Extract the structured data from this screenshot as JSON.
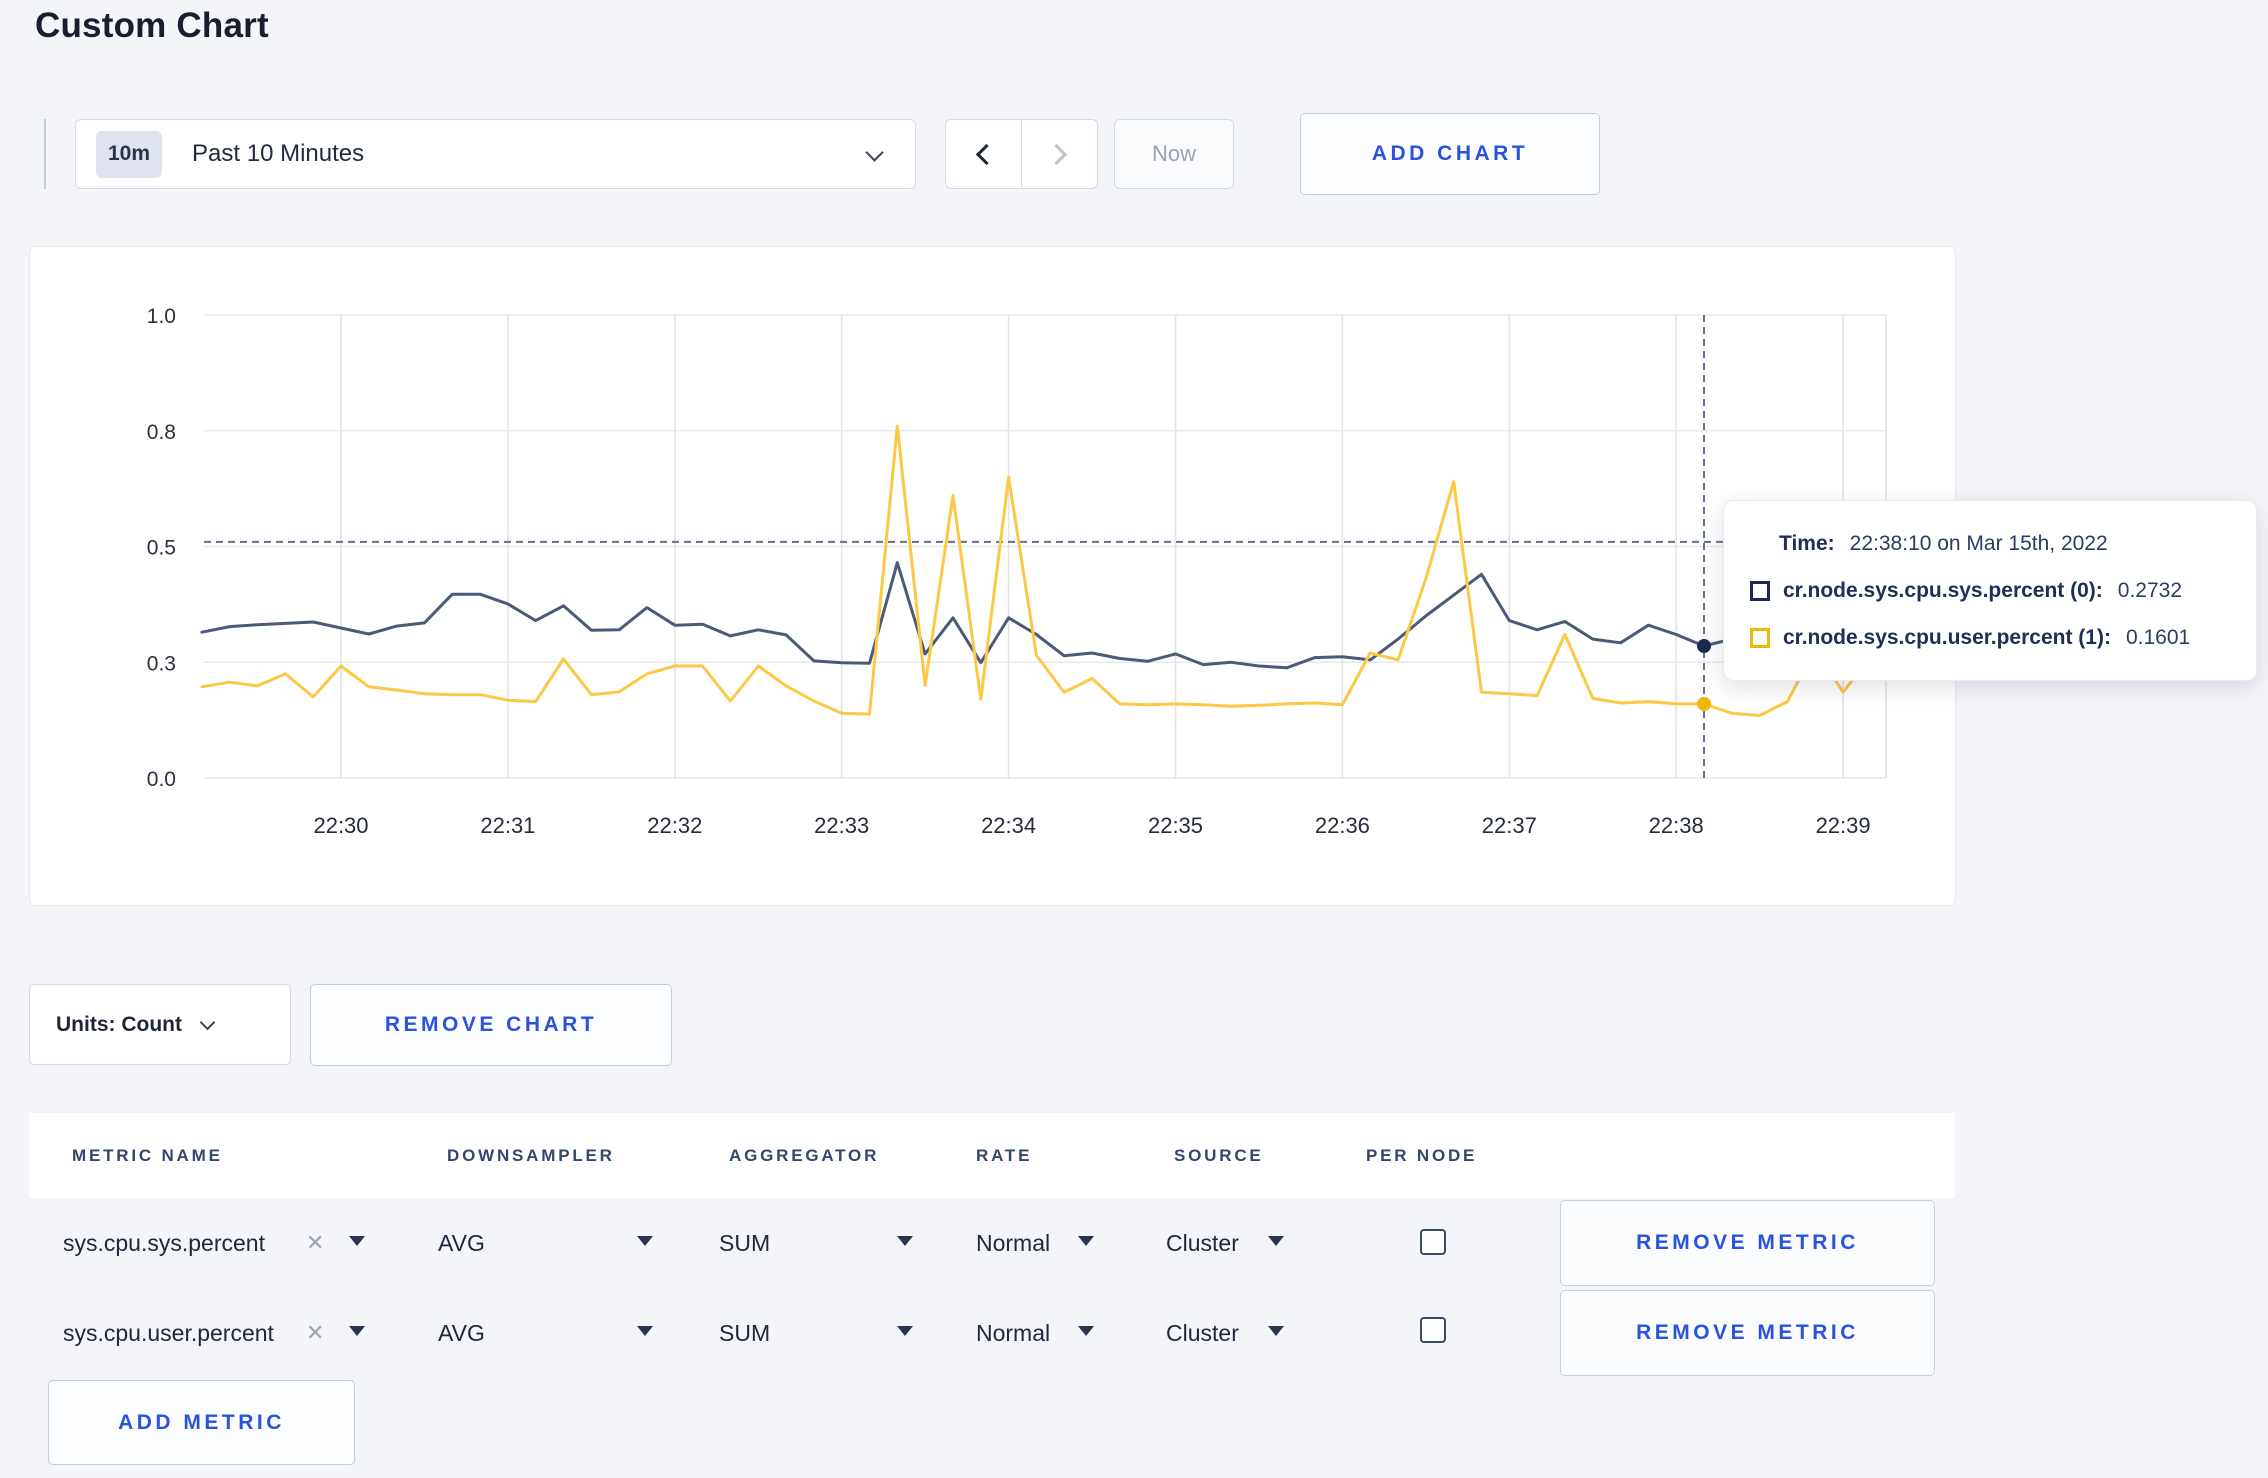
{
  "page": {
    "title": "Custom Chart",
    "background": "#f4f5f9",
    "accent_blue": "#2b52dc"
  },
  "toolbar": {
    "time_window": {
      "badge": "10m",
      "label": "Past 10 Minutes"
    },
    "now_label": "Now",
    "add_chart_label": "ADD CHART"
  },
  "tooltip": {
    "time_label": "Time:",
    "time_value": "22:38:10 on Mar 15th, 2022",
    "series": [
      {
        "name": "cr.node.sys.cpu.sys.percent (0):",
        "value": "0.2732",
        "color": "#1c2a4e"
      },
      {
        "name": "cr.node.sys.cpu.user.percent (1):",
        "value": "0.1601",
        "color": "#f2b70e"
      }
    ]
  },
  "chart_controls": {
    "units_label": "Units: Count",
    "remove_chart_label": "REMOVE CHART"
  },
  "metrics_table": {
    "headers": [
      "METRIC NAME",
      "DOWNSAMPLER",
      "AGGREGATOR",
      "RATE",
      "SOURCE",
      "PER NODE"
    ],
    "rows": [
      {
        "metric": "sys.cpu.sys.percent",
        "downsampler": "AVG",
        "aggregator": "SUM",
        "rate": "Normal",
        "source": "Cluster",
        "per_node": false,
        "remove_label": "REMOVE METRIC"
      },
      {
        "metric": "sys.cpu.user.percent",
        "downsampler": "AVG",
        "aggregator": "SUM",
        "rate": "Normal",
        "source": "Cluster",
        "per_node": false,
        "remove_label": "REMOVE METRIC"
      }
    ],
    "add_metric_label": "ADD METRIC",
    "close_icon_glyph": "✕"
  },
  "chart_data": {
    "type": "line",
    "title": "",
    "x_start_time": "22:29:10",
    "x_interval_seconds": 10,
    "point_count": 61,
    "x_tick_labels": [
      "22:30",
      "22:31",
      "22:32",
      "22:33",
      "22:34",
      "22:35",
      "22:36",
      "22:37",
      "22:38",
      "22:39"
    ],
    "y_tick_labels": [
      "0.0",
      "0.3",
      "0.5",
      "0.8",
      "1.0"
    ],
    "y_tick_values": [
      0,
      0.25,
      0.5,
      0.75,
      1.0
    ],
    "ylim": [
      0,
      1
    ],
    "grid": true,
    "legend_position": "tooltip-only",
    "series": [
      {
        "name": "cr.node.sys.cpu.sys.percent",
        "color": "#4a5a78",
        "values": [
          0.315,
          0.327,
          0.331,
          0.334,
          0.337,
          0.324,
          0.311,
          0.328,
          0.335,
          0.397,
          0.397,
          0.376,
          0.34,
          0.372,
          0.319,
          0.32,
          0.368,
          0.33,
          0.332,
          0.307,
          0.32,
          0.309,
          0.253,
          0.249,
          0.248,
          0.465,
          0.268,
          0.346,
          0.249,
          0.346,
          0.31,
          0.264,
          0.27,
          0.258,
          0.252,
          0.268,
          0.245,
          0.25,
          0.242,
          0.238,
          0.26,
          0.262,
          0.255,
          0.3,
          0.35,
          0.395,
          0.44,
          0.34,
          0.32,
          0.338,
          0.3,
          0.292,
          0.33,
          0.31,
          0.285,
          0.3,
          0.295,
          0.3,
          0.31,
          0.3,
          0.305
        ]
      },
      {
        "name": "cr.node.sys.cpu.user.percent",
        "color": "#fdc845",
        "values": [
          0.197,
          0.207,
          0.199,
          0.225,
          0.175,
          0.242,
          0.197,
          0.19,
          0.182,
          0.18,
          0.18,
          0.168,
          0.165,
          0.257,
          0.18,
          0.186,
          0.225,
          0.242,
          0.242,
          0.166,
          0.242,
          0.199,
          0.166,
          0.14,
          0.138,
          0.76,
          0.2,
          0.61,
          0.17,
          0.65,
          0.265,
          0.185,
          0.215,
          0.16,
          0.158,
          0.16,
          0.158,
          0.155,
          0.157,
          0.16,
          0.162,
          0.158,
          0.27,
          0.255,
          0.43,
          0.64,
          0.185,
          0.182,
          0.178,
          0.31,
          0.172,
          0.162,
          0.165,
          0.16,
          0.1601,
          0.14,
          0.135,
          0.165,
          0.28,
          0.185,
          0.265
        ]
      }
    ],
    "crosshair": {
      "time": "22:38:10",
      "index": 54,
      "hline_value": 0.51
    }
  }
}
